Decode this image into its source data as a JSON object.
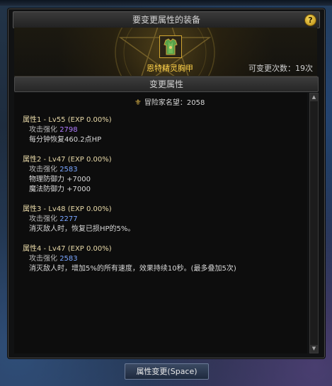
{
  "window": {
    "title": "要变更属性的装备",
    "help_label": "?"
  },
  "item": {
    "name": "恩特精灵胸甲",
    "change_count_text": "可变更次数：19次"
  },
  "section": {
    "title": "变更属性"
  },
  "fame": {
    "text": "冒险家名望：2058"
  },
  "attributes": [
    {
      "title": "属性1 - Lv55 (EXP 0.00%)",
      "attack_label": "攻击强化",
      "attack_value": "2798",
      "effects": [
        "每分钟恢复460.2点HP"
      ]
    },
    {
      "title": "属性2 - Lv47 (EXP 0.00%)",
      "attack_label": "攻击强化",
      "attack_value": "2583",
      "effects": [
        "物理防御力 +7000",
        "魔法防御力 +7000"
      ]
    },
    {
      "title": "属性3 - Lv48 (EXP 0.00%)",
      "attack_label": "攻击强化",
      "attack_value": "2277",
      "effects": [
        "消灭敌人时，恢复已损HP的5%。"
      ]
    },
    {
      "title": "属性4 - Lv47 (EXP 0.00%)",
      "attack_label": "攻击强化",
      "attack_value": "2583",
      "effects": [
        "消灭敌人时，增加5%的所有速度，效果持续10秒。(最多叠加5次)"
      ]
    }
  ],
  "footer": {
    "button_label": "属性变更(Space)"
  },
  "colors": {
    "item_name": "#ffd24a",
    "attack_purple": "#b07cff",
    "attack_blue": "#7aa6ff",
    "icon_border": "#d2a632"
  },
  "icons": {
    "help": "help-icon",
    "fame": "fame-icon",
    "item": "chest-armor-icon"
  }
}
